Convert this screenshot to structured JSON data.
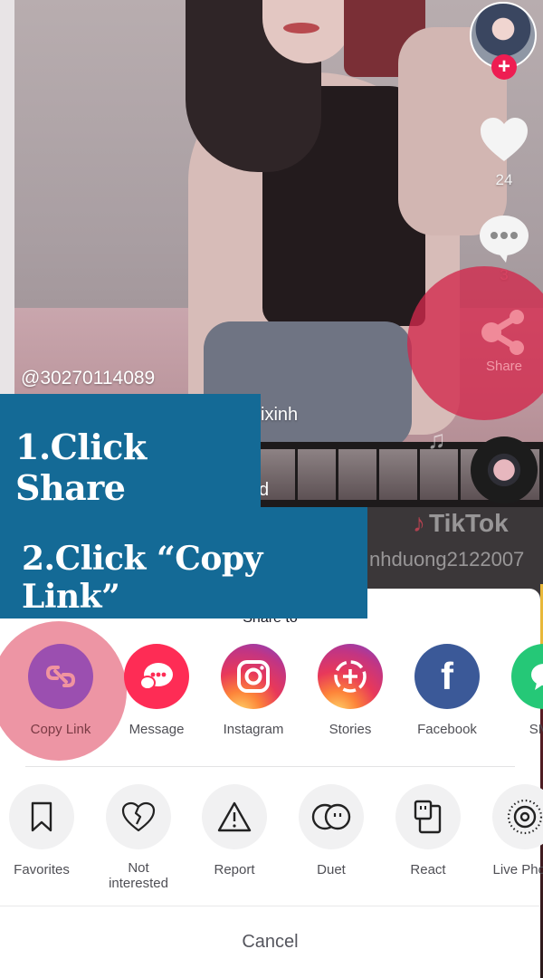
{
  "video": {
    "username": "@30270114089",
    "caption_visible_fragment": "ixinh",
    "caption_line2_fragment": "d",
    "watermark": {
      "logo": "TikTok",
      "user_fragment": "nhduong2122007"
    }
  },
  "rail": {
    "follow_icon": "plus-icon",
    "likes": "24",
    "comments": "3",
    "share_label": "Share"
  },
  "tutorial": {
    "step1": "1.Click Share",
    "step2": "2.Click “Copy Link”"
  },
  "share_sheet": {
    "title": "Share to",
    "targets": [
      {
        "label": "Copy Link",
        "icon": "link-icon",
        "color": "#9b4fb0",
        "highlighted": true
      },
      {
        "label": "Message",
        "icon": "message-icon",
        "color": "#fe2c55"
      },
      {
        "label": "Instagram",
        "icon": "instagram-icon",
        "color": "#d6249f"
      },
      {
        "label": "Stories",
        "icon": "stories-icon",
        "color": "#c13584"
      },
      {
        "label": "Facebook",
        "icon": "facebook-icon",
        "color": "#3b5998"
      },
      {
        "label": "SMS",
        "icon": "sms-icon",
        "color": "#25d366"
      }
    ],
    "actions": [
      {
        "label": "Favorites",
        "icon": "bookmark-icon"
      },
      {
        "label": "Not interested",
        "icon": "broken-heart-icon"
      },
      {
        "label": "Report",
        "icon": "warning-icon"
      },
      {
        "label": "Duet",
        "icon": "duet-icon"
      },
      {
        "label": "React",
        "icon": "react-icon"
      },
      {
        "label": "Live Photo",
        "icon": "live-photo-icon"
      }
    ],
    "cancel_label": "Cancel"
  },
  "colors": {
    "tutorial_box": "#146a96",
    "highlight_red": "#d2284b",
    "highlight_pink": "#ea8294",
    "tiktok_red": "#ee1d52"
  }
}
